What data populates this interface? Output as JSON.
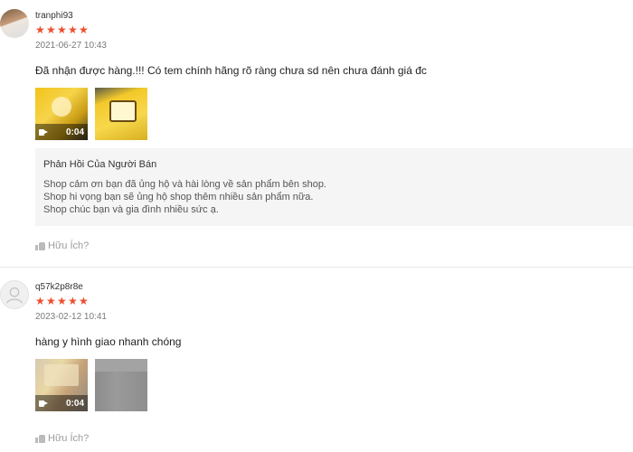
{
  "reviews": [
    {
      "username": "tranphi93",
      "stars": [
        "★",
        "★",
        "★",
        "★",
        "★"
      ],
      "date": "2021-06-27 10:43",
      "content": "Đã nhận được hàng.!!! Có tem chính hãng rõ ràng chưa sd nên chưa đánh giá đc",
      "media": [
        {
          "type": "video",
          "duration": "0:04"
        },
        {
          "type": "image"
        }
      ],
      "shop_reply": {
        "title": "Phản Hồi Của Người Bán",
        "lines": [
          "Shop cảm ơn bạn đã ủng hộ và hài lòng về sản phẩm bên shop.",
          "Shop hi vọng bạn sẽ ủng hộ shop thêm nhiều sản phẩm nữa.",
          "Shop chúc bạn và gia đình nhiều sức ạ."
        ]
      },
      "helpful_label": "Hữu Ích?"
    },
    {
      "username": "q57k2p8r8e",
      "stars": [
        "★",
        "★",
        "★",
        "★",
        "★"
      ],
      "date": "2023-02-12 10:41",
      "content": "hàng y hình giao nhanh chóng",
      "media": [
        {
          "type": "video",
          "duration": "0:04"
        },
        {
          "type": "image"
        }
      ],
      "helpful_label": "Hữu Ích?"
    }
  ],
  "colors": {
    "star": "#ee4d2d",
    "reply_bg": "#f5f5f5",
    "muted": "#999999"
  },
  "icons": [
    "video-camera-icon",
    "thumbs-up-icon",
    "default-user-icon"
  ]
}
